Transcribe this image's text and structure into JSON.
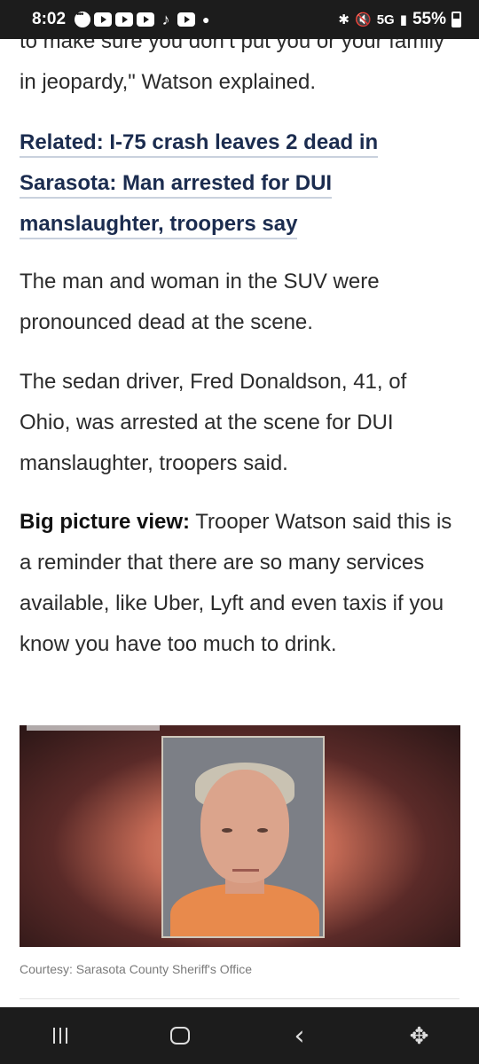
{
  "status_bar": {
    "time": "8:02",
    "network": "5G",
    "battery": "55%"
  },
  "article": {
    "paragraph_1": "to make sure you don’t put you or your family in jeopardy,\" Watson explained.",
    "related_lines": [
      "Related: I-75 crash leaves 2 dead in",
      "Sarasota: Man arrested for DUI",
      "manslaughter, troopers say"
    ],
    "paragraph_2": "The man and woman in the SUV were pronounced dead at the scene.",
    "paragraph_3": "The sedan driver, Fred Donaldson, 41, of Ohio, was arrested at the scene for DUI manslaughter, troopers said.",
    "paragraph_4_bold": "Big picture view:",
    "paragraph_4": " Trooper Watson said this is a reminder that there are so many services available, like Uber, Lyft and even taxis if you know you have too much to drink.",
    "photo_credit": "Courtesy: Sarasota County Sheriff's Office"
  },
  "nav": {
    "recent_icon": "recent-apps-icon",
    "home_icon": "home-icon",
    "back_icon": "back-icon",
    "accessibility_icon": "accessibility-icon"
  }
}
